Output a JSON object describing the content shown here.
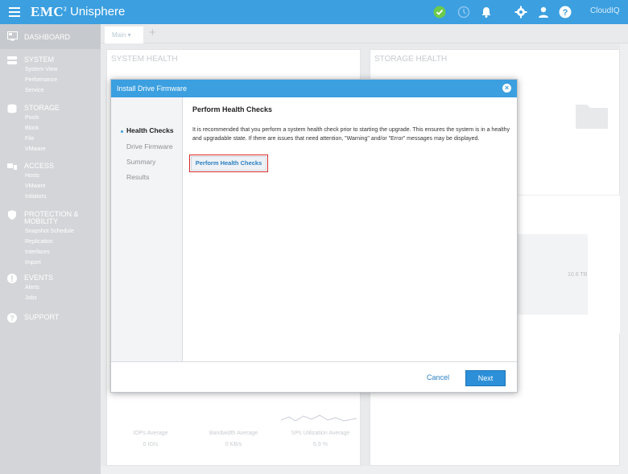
{
  "topbar": {
    "brand": "EMC",
    "brand_sup": "2",
    "app_name": "Unisphere",
    "cloud_label": "CloudIQ",
    "status_color": "#6ccb4c"
  },
  "sidebar": {
    "dashboard": "DASHBOARD",
    "sections": [
      {
        "head": "SYSTEM",
        "items": [
          "System View",
          "Performance",
          "Service"
        ]
      },
      {
        "head": "STORAGE",
        "items": [
          "Pools",
          "Block",
          "File",
          "VMware"
        ]
      },
      {
        "head": "ACCESS",
        "items": [
          "Hosts",
          "VMware",
          "Initiators"
        ]
      },
      {
        "head": "PROTECTION &",
        "head2": "MOBILITY",
        "items": [
          "Snapshot Schedule",
          "Replication",
          "Interfaces",
          "Import"
        ]
      },
      {
        "head": "EVENTS",
        "items": [
          "Alerts",
          "Jobs"
        ]
      },
      {
        "head": "SUPPORT",
        "items": []
      }
    ]
  },
  "dashboard": {
    "tab_main": "Main",
    "system_health": "SYSTEM HEALTH",
    "storage_health": "STORAGE HEALTH",
    "capacity_label": "10.6 TB",
    "stats": [
      {
        "label": "IOPs Average",
        "value": "0 IO/s"
      },
      {
        "label": "Bandwidth Average",
        "value": "0 KB/s"
      },
      {
        "label": "SPs Utilization Average",
        "value": "6.9 %"
      }
    ]
  },
  "modal": {
    "title": "Install Drive Firmware",
    "steps": [
      "Health Checks",
      "Drive Firmware",
      "Summary",
      "Results"
    ],
    "heading": "Perform Health Checks",
    "description": "It is recommended that you perform a system health check prior to starting the upgrade. This ensures the system is in a healthy and upgradable state. If there are issues that need attention, \"Warning\" and/or \"Error\" messages may be displayed.",
    "button": "Perform Health Checks",
    "cancel": "Cancel",
    "next": "Next"
  }
}
